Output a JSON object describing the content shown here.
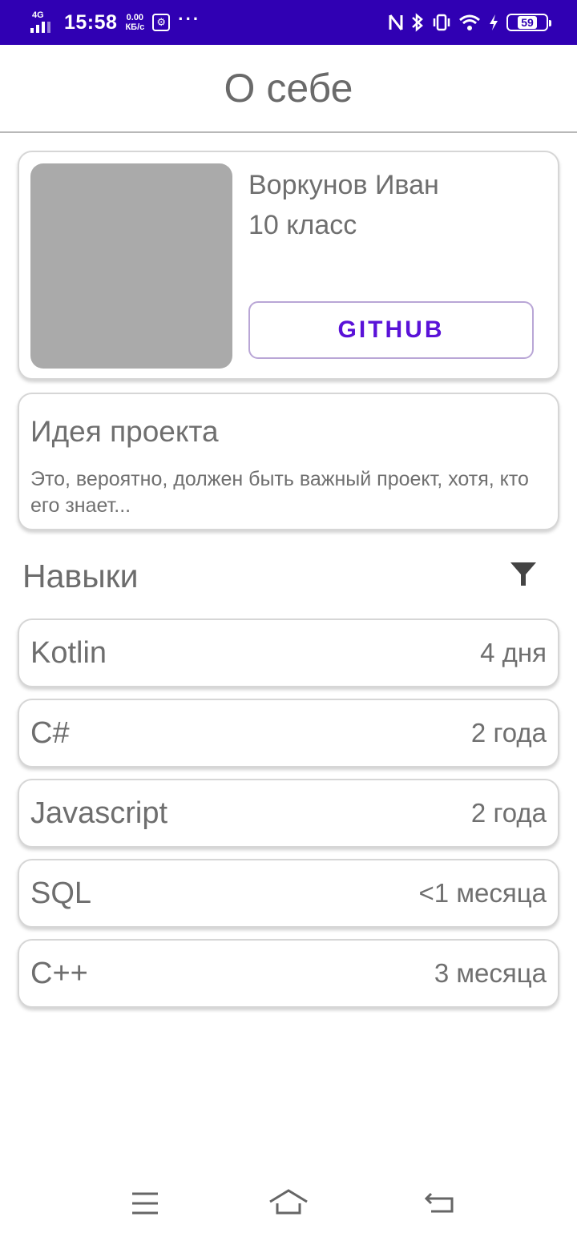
{
  "status_bar": {
    "network": "4G",
    "time": "15:58",
    "speed_value": "0.00",
    "speed_unit": "КБ/с",
    "more": "···",
    "battery": "59",
    "accent": "#3000b3"
  },
  "header": {
    "title": "О себе"
  },
  "profile": {
    "name": "Воркунов Иван",
    "grade": "10 класс",
    "github_label": "GITHUB"
  },
  "idea": {
    "title": "Идея проекта",
    "text": "Это, вероятно, должен быть важный проект, хотя, кто его знает..."
  },
  "skills": {
    "title": "Навыки",
    "items": [
      {
        "name": "Kotlin",
        "duration": "4 дня"
      },
      {
        "name": "C#",
        "duration": "2 года"
      },
      {
        "name": "Javascript",
        "duration": "2 года"
      },
      {
        "name": "SQL",
        "duration": "<1 месяца"
      },
      {
        "name": "C++",
        "duration": "3 месяца"
      }
    ]
  },
  "icons": {
    "filter": "filter-icon",
    "menu": "menu-icon",
    "home": "home-icon",
    "back": "back-icon"
  }
}
